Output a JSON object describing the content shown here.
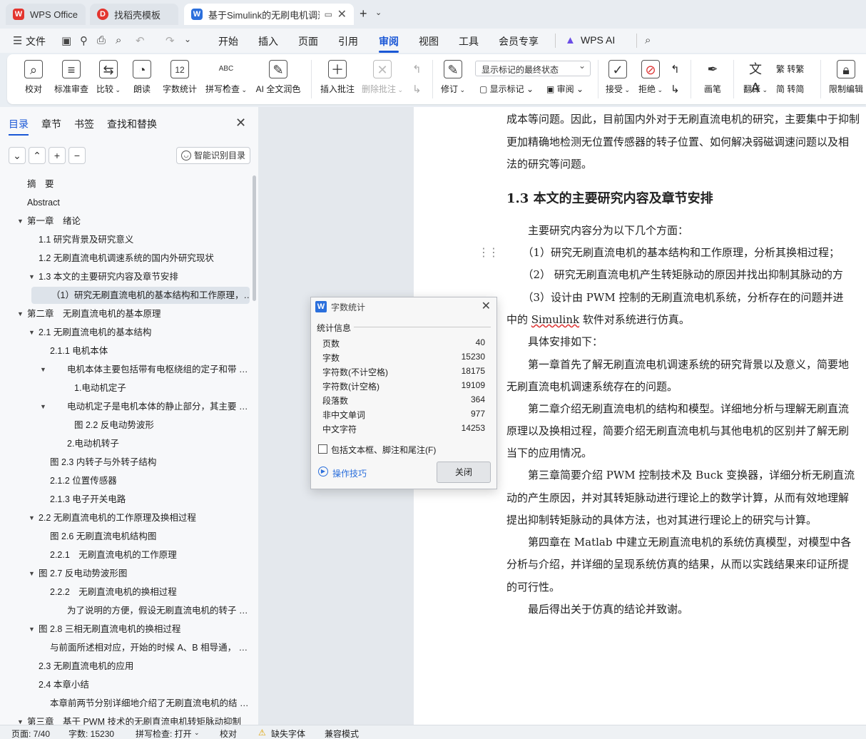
{
  "tabs": [
    {
      "label": "WPS Office",
      "icon": "W"
    },
    {
      "label": "找稻壳模板",
      "icon": "D"
    },
    {
      "label": "基于Simulink的无刷电机调速",
      "icon": "W"
    }
  ],
  "menu": {
    "file": "文件",
    "items": [
      "开始",
      "插入",
      "页面",
      "引用",
      "审阅",
      "视图",
      "工具",
      "会员专享"
    ],
    "active": "审阅",
    "wps_ai": "WPS AI"
  },
  "ribbon": {
    "proofread": "校对",
    "std_review": "标准审查",
    "compare": "比较",
    "read_aloud": "朗读",
    "word_count": "字数统计",
    "spell_check": "拼写检查",
    "ai_polish": "AI 全文润色",
    "insert_comment": "插入批注",
    "delete_comment": "删除批注",
    "revise": "修订",
    "markup_select": "显示标记的最终状态",
    "show_markup": "显示标记",
    "review": "审阅",
    "accept": "接受",
    "reject": "拒绝",
    "pen": "画笔",
    "translate": "翻译",
    "to_trad": "转繁",
    "to_simp": "转简",
    "restrict_edit": "限制编辑"
  },
  "nav": {
    "tabs": [
      "目录",
      "章节",
      "书签",
      "查找和替换"
    ],
    "smart_btn": "智能识别目录",
    "toc": [
      {
        "text": "摘　要",
        "level": 0,
        "caret": false
      },
      {
        "text": "Abstract",
        "level": 0,
        "caret": false
      },
      {
        "text": "第一章　绪论",
        "level": 0,
        "caret": true
      },
      {
        "text": "1.1 研究背景及研究意义",
        "level": 1,
        "caret": false
      },
      {
        "text": "1.2 无刷直流电机调速系统的国内外研究现状",
        "level": 1,
        "caret": false
      },
      {
        "text": "1.3 本文的主要研究内容及章节安排",
        "level": 1,
        "caret": true
      },
      {
        "text": "（1）研究无刷直流电机的基本结构和工作原理，…",
        "level": 2,
        "caret": false,
        "selected": true
      },
      {
        "text": "第二章　无刷直流电机的基本原理",
        "level": 0,
        "caret": true
      },
      {
        "text": "2.1 无刷直流电机的基本结构",
        "level": 1,
        "caret": true
      },
      {
        "text": "2.1.1 电机本体",
        "level": 2,
        "caret": false
      },
      {
        "text": "电机本体主要包括带有电枢绕组的定子和带 …",
        "level": 3,
        "caret": true
      },
      {
        "text": "1.电动机定子",
        "level": 4,
        "caret": false
      },
      {
        "text": "电动机定子是电机本体的静止部分，其主要 …",
        "level": 3,
        "caret": true
      },
      {
        "text": "图 2.2 反电动势波形",
        "level": 4,
        "caret": false
      },
      {
        "text": "2.电动机转子",
        "level": 3,
        "caret": false
      },
      {
        "text": "图 2.3 内转子与外转子结构",
        "level": 2,
        "caret": false
      },
      {
        "text": "2.1.2 位置传感器",
        "level": 2,
        "caret": false
      },
      {
        "text": "2.1.3 电子开关电路",
        "level": 2,
        "caret": false
      },
      {
        "text": "2.2 无刷直流电机的工作原理及换相过程",
        "level": 1,
        "caret": true
      },
      {
        "text": "图 2.6 无刷直流电机结构图",
        "level": 2,
        "caret": false
      },
      {
        "text": "2.2.1　无刷直流电机的工作原理",
        "level": 2,
        "caret": false
      },
      {
        "text": "图 2.7 反电动势波形图",
        "level": 1,
        "caret": true
      },
      {
        "text": "2.2.2　无刷直流电机的换相过程",
        "level": 2,
        "caret": false
      },
      {
        "text": "为了说明的方便，假设无刷直流电机的转子 …",
        "level": 3,
        "caret": false
      },
      {
        "text": "图 2.8 三相无刷直流电机的换相过程",
        "level": 1,
        "caret": true
      },
      {
        "text": "与前面所述相对应，开始的时候 A、B 相导通， …",
        "level": 2,
        "caret": false
      },
      {
        "text": "2.3 无刷直流电机的应用",
        "level": 1,
        "caret": false
      },
      {
        "text": "2.4 本章小结",
        "level": 1,
        "caret": false
      },
      {
        "text": "本章前两节分别详细地介绍了无刷直流电机的结 …",
        "level": 2,
        "caret": false
      },
      {
        "text": "第三章　基于 PWM 技术的无刷直流电机转矩脉动抑制",
        "level": 0,
        "caret": true
      }
    ]
  },
  "document": {
    "lines": [
      "成本等问题。因此，目前国内外对于无刷直流电机的研究，主要集中于抑制",
      "更加精确地检测无位置传感器的转子位置、如何解决弱磁调速问题以及相",
      "法的研究等问题。"
    ],
    "heading": "1.3  本文的主要研究内容及章节安排",
    "body": [
      "　　主要研究内容分为以下几个方面：",
      "　　（1）研究无刷直流电机的基本结构和工作原理，分析其换相过程；",
      "　　（2）  研究无刷直流电机产生转矩脉动的原因并找出抑制其脉动的方",
      "　　（3）设计由 PWM 控制的无刷直流电机系统，分析存在的问题并进",
      "中的 ",
      "　　具体安排如下：",
      "　　第一章首先了解无刷直流电机调速系统的研究背景以及意义，简要地",
      "无刷直流电机调速系统存在的问题。",
      "　　第二章介绍无刷直流电机的结构和模型。详细地分析与理解无刷直流",
      "原理以及换相过程，简要介绍无刷直流电机与其他电机的区别并了解无刷",
      "当下的应用情况。",
      "　　第三章简要介绍 PWM 控制技术及 Buck 变换器，详细分析无刷直流",
      "动的产生原因，并对其转矩脉动进行理论上的数学计算，从而有效地理解",
      "提出抑制转矩脉动的具体方法，也对其进行理论上的研究与计算。",
      "　　第四章在 Matlab 中建立无刷直流电机的系统仿真模型，对模型中各",
      "分析与介绍，并详细的呈现系统仿真的结果，从而以实践结果来印证所提",
      "的可行性。",
      "　　最后得出关于仿真的结论并致谢。"
    ],
    "simulink_word": "Simulink",
    "simulink_tail": " 软件对系统进行仿真。"
  },
  "dialog": {
    "title": "字数统计",
    "section": "统计信息",
    "stats": [
      {
        "label": "页数",
        "value": "40"
      },
      {
        "label": "字数",
        "value": "15230"
      },
      {
        "label": "字符数(不计空格)",
        "value": "18175"
      },
      {
        "label": "字符数(计空格)",
        "value": "19109"
      },
      {
        "label": "段落数",
        "value": "364"
      },
      {
        "label": "非中文单词",
        "value": "977"
      },
      {
        "label": "中文字符",
        "value": "14253"
      }
    ],
    "checkbox_label": "包括文本框、脚注和尾注(F)",
    "tips": "操作技巧",
    "close_btn": "关闭"
  },
  "status": {
    "page": "页面: 7/40",
    "words": "字数: 15230",
    "spell": "拼写检查: 打开",
    "proof": "校对",
    "missing_font": "缺失字体",
    "compat": "兼容模式"
  },
  "colors": {
    "accent": "#1a57d6",
    "wps_red": "#e3352f",
    "doc_bg": "#ffffff"
  }
}
